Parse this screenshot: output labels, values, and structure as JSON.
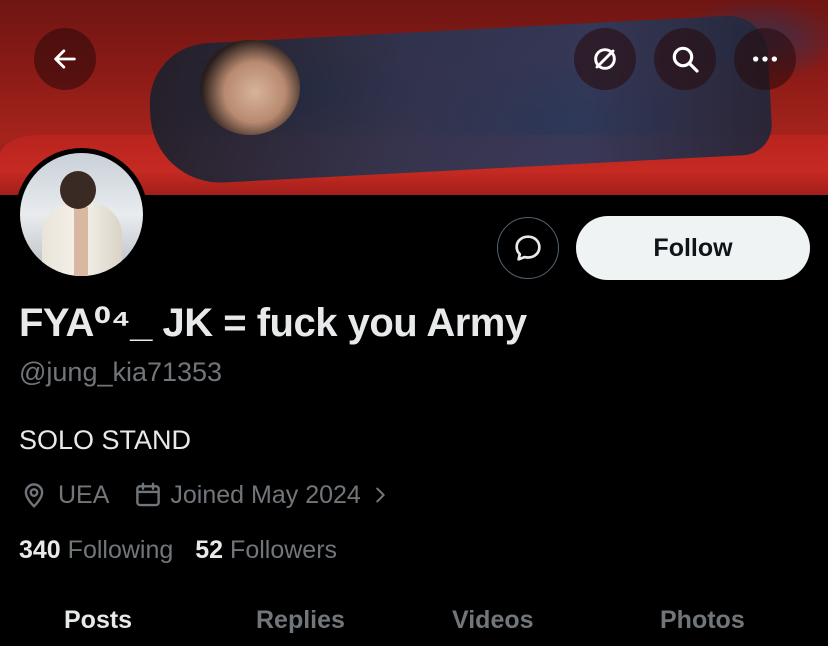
{
  "header": {
    "back_icon": "arrow-left-icon",
    "hide_icon": "eye-slash-circle-icon",
    "search_icon": "search-icon",
    "more_icon": "more-horizontal-icon"
  },
  "profile": {
    "display_name": "FYA⁰⁴_ JK = fuck you Army",
    "handle": "@jung_kia71353",
    "bio": "SOLO STAND",
    "location": "UEA",
    "joined": "Joined May 2024",
    "following_count": "340",
    "following_label": "Following",
    "followers_count": "52",
    "followers_label": "Followers"
  },
  "actions": {
    "follow_label": "Follow",
    "message_icon": "message-bubble-icon"
  },
  "tabs": [
    {
      "label": "Posts"
    },
    {
      "label": "Replies"
    },
    {
      "label": "Videos"
    },
    {
      "label": "Photos"
    }
  ],
  "colors": {
    "background": "#000000",
    "primary_text": "#e7e9ea",
    "secondary_text": "#71767b",
    "follow_button_bg": "#eff3f4",
    "banner_red": "#a5231d"
  }
}
